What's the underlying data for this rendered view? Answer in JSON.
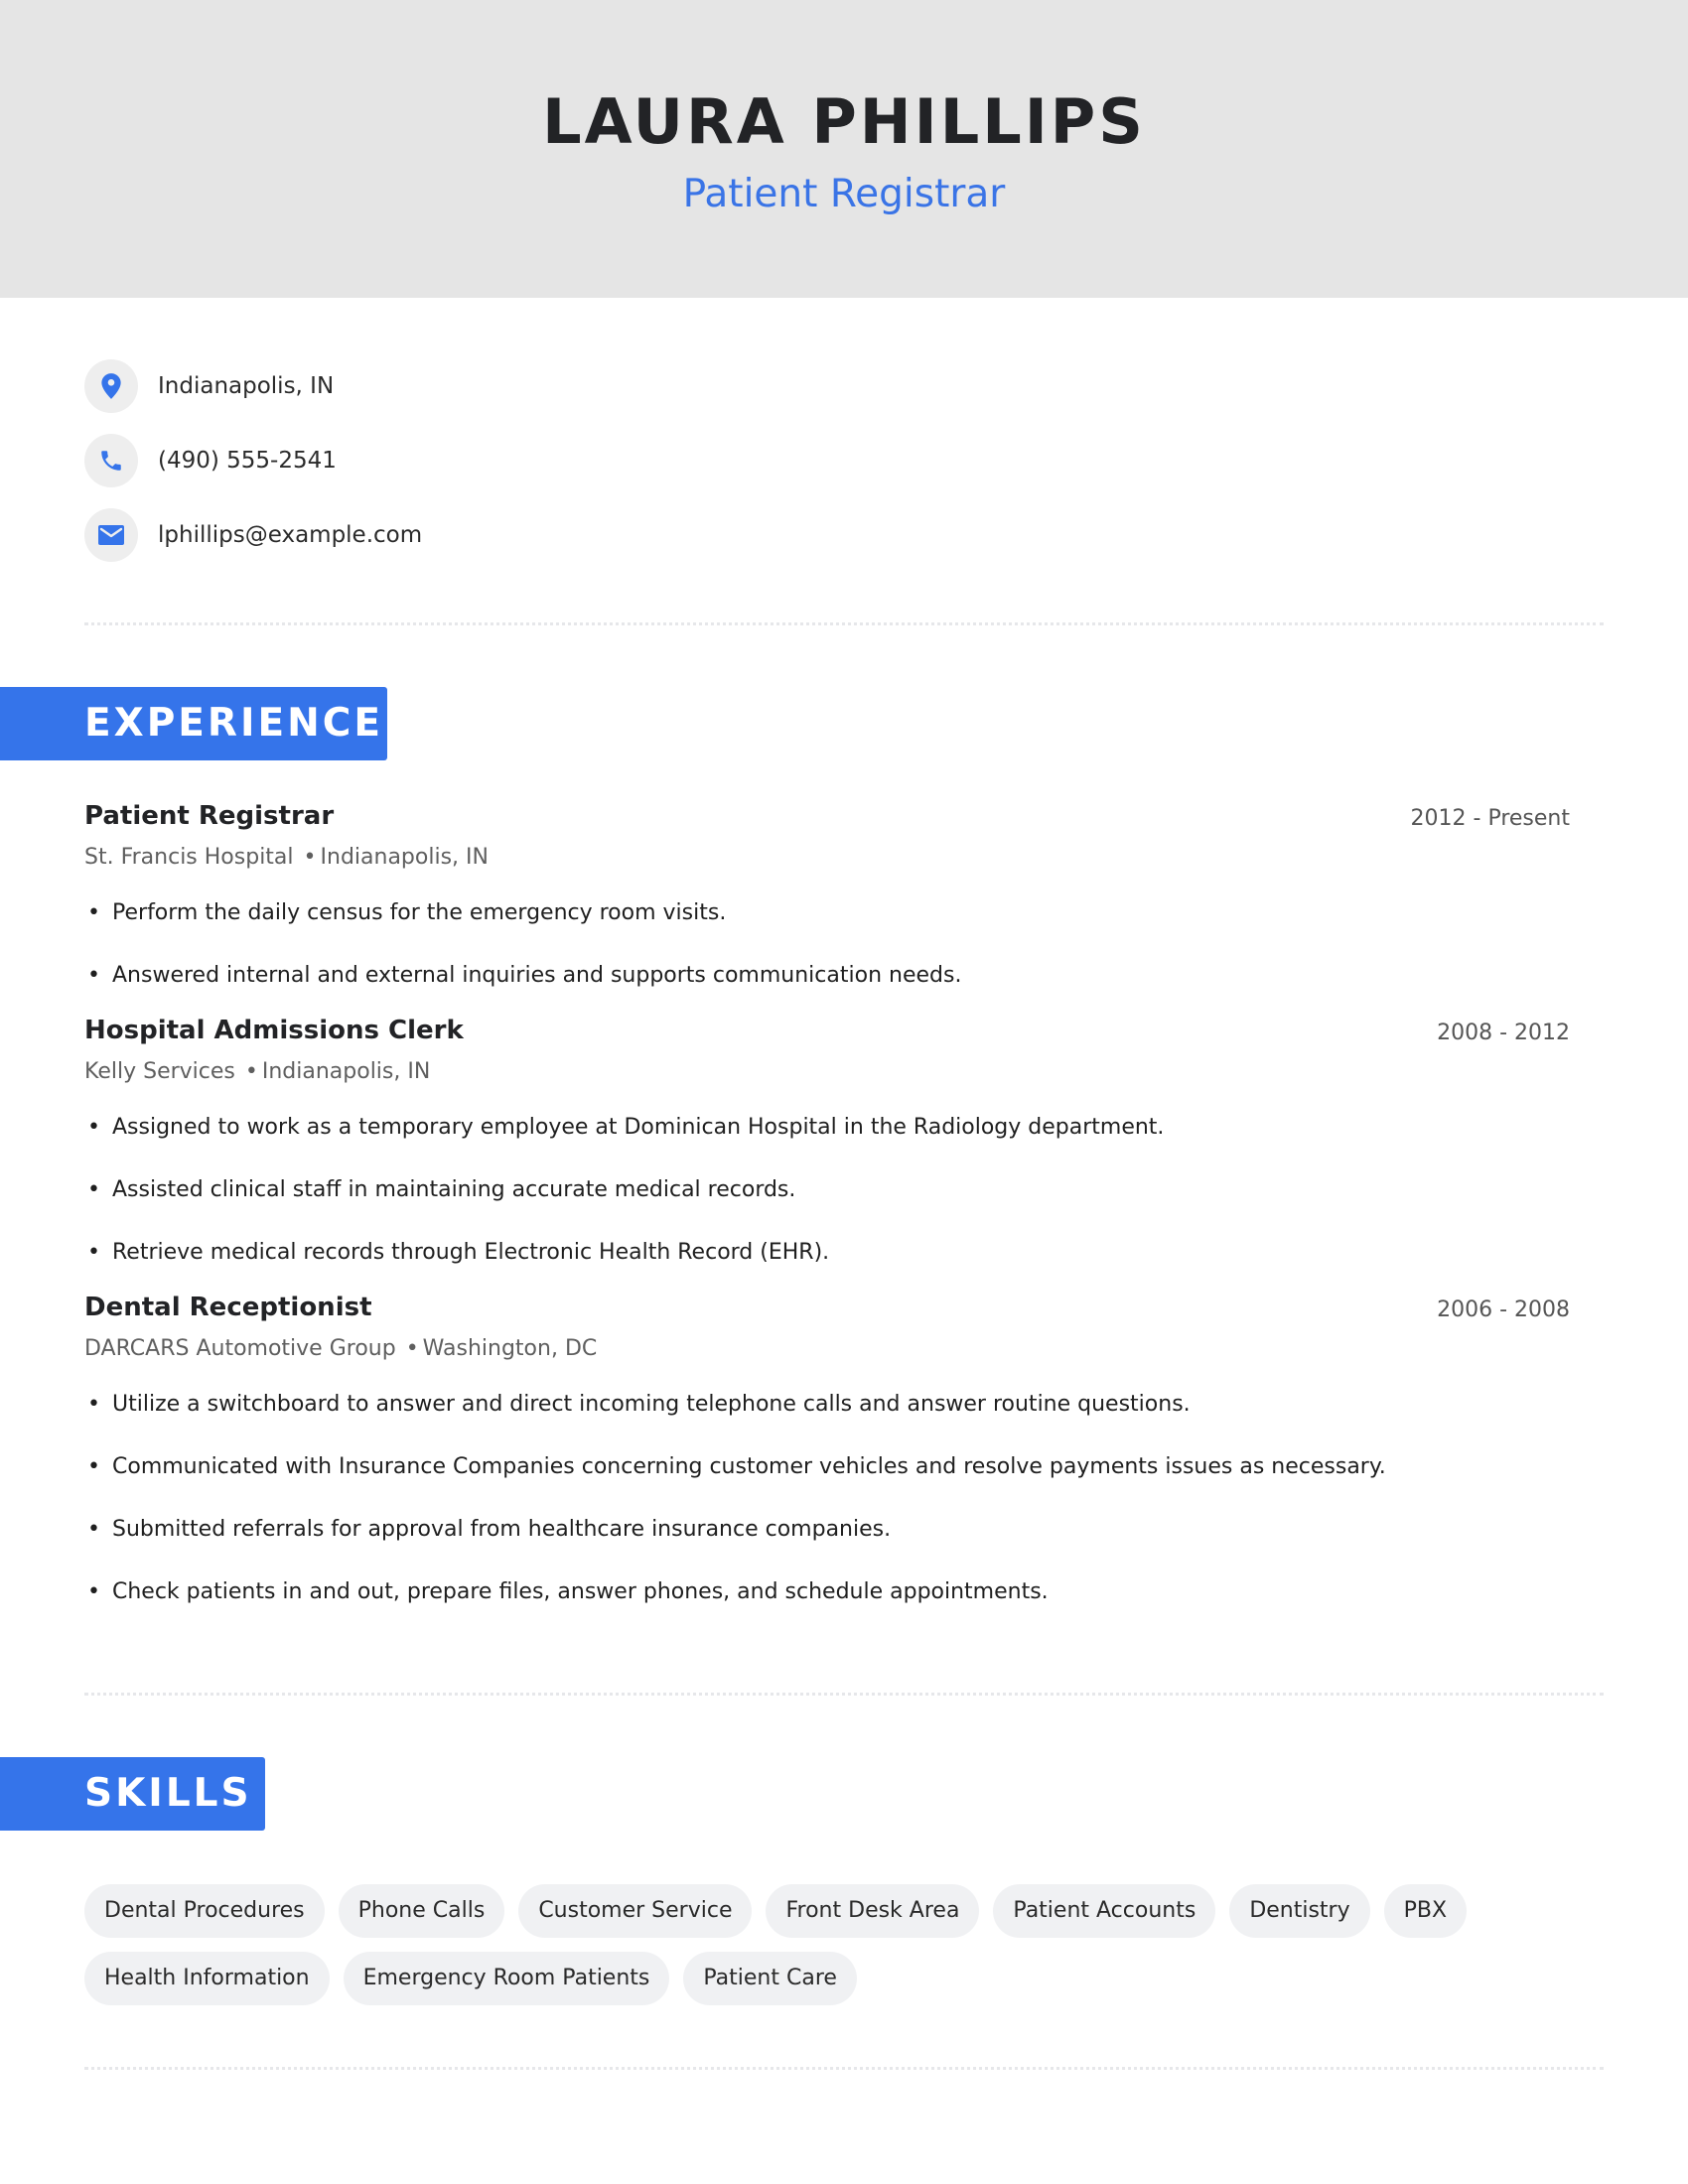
{
  "header": {
    "name": "LAURA PHILLIPS",
    "title": "Patient Registrar"
  },
  "contact": {
    "location": {
      "icon": "map-pin-icon",
      "text": "Indianapolis, IN"
    },
    "phone": {
      "icon": "phone-icon",
      "text": "(490) 555-2541"
    },
    "email": {
      "icon": "mail-icon",
      "text": "lphillips@example.com"
    }
  },
  "colors": {
    "accent": "#3574ea",
    "header_bg": "#e5e5e5",
    "chip_bg": "#f0f1f3"
  },
  "experience": {
    "heading": "EXPERIENCE",
    "jobs": [
      {
        "title": "Patient Registrar",
        "company": "St. Francis Hospital",
        "location": "Indianapolis, IN",
        "dates": "2012 - Present",
        "bullets": [
          "Perform the daily census for the emergency room visits.",
          "Answered internal and external inquiries and supports communication needs."
        ]
      },
      {
        "title": "Hospital Admissions Clerk",
        "company": "Kelly Services",
        "location": "Indianapolis, IN",
        "dates": "2008 - 2012",
        "bullets": [
          "Assigned to work as a temporary employee at Dominican Hospital in the Radiology department.",
          "Assisted clinical staff in maintaining accurate medical records.",
          "Retrieve medical records through Electronic Health Record (EHR)."
        ]
      },
      {
        "title": "Dental Receptionist",
        "company": "DARCARS Automotive Group",
        "location": "Washington, DC",
        "dates": "2006 - 2008",
        "bullets": [
          "Utilize a switchboard to answer and direct incoming telephone calls and answer routine questions.",
          "Communicated with Insurance Companies concerning customer vehicles and resolve payments issues as necessary.",
          "Submitted referrals for approval from healthcare insurance companies.",
          "Check patients in and out, prepare files, answer phones, and schedule appointments."
        ]
      }
    ]
  },
  "skills": {
    "heading": "SKILLS",
    "items": [
      "Dental Procedures",
      "Phone Calls",
      "Customer Service",
      "Front Desk Area",
      "Patient Accounts",
      "Dentistry",
      "PBX",
      "Health Information",
      "Emergency Room Patients",
      "Patient Care"
    ]
  },
  "bullet_glyph": "•",
  "separator_glyph": "•"
}
